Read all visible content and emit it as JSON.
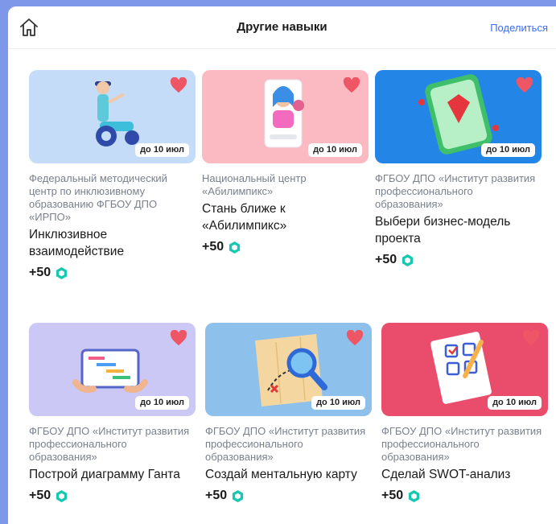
{
  "header": {
    "title": "Другие навыки",
    "share_label": "Поделиться"
  },
  "colors": {
    "accent": "#3b6cf6",
    "heart": "#ee5666",
    "gem": "#17c8b0"
  },
  "cards": [
    {
      "org": "Федеральный методический центр по инклюзивному образованию ФГБОУ ДПО «ИРПО»",
      "name": "Инклюзивное взаимодействие",
      "deadline": "до 10 июл",
      "points": "+50",
      "bg": "#c4dcf8"
    },
    {
      "org": "Национальный центр «Абилимпикс»",
      "name": "Стань ближе к «Абилимпикс»",
      "deadline": "до 10 июл",
      "points": "+50",
      "bg": "#fbb9c2"
    },
    {
      "org": "ФГБОУ ДПО «Институт развития профессионального образования»",
      "name": "Выбери бизнес-модель проекта",
      "deadline": "до 10 июл",
      "points": "+50",
      "bg": "#2386e6"
    },
    {
      "org": "ФГБОУ ДПО «Институт развития профессионального образования»",
      "name": "Построй диаграмму Ганта",
      "deadline": "до 10 июл",
      "points": "+50",
      "bg": "#ccc8f6"
    },
    {
      "org": "ФГБОУ ДПО «Институт развития профессионального образования»",
      "name": "Создай ментальную карту",
      "deadline": "до 10 июл",
      "points": "+50",
      "bg": "#8dc0ea"
    },
    {
      "org": "ФГБОУ ДПО «Институт развития профессионального образования»",
      "name": "Сделай SWOT-анализ",
      "deadline": "до 10 июл",
      "points": "+50",
      "bg": "#ea4d6c"
    }
  ]
}
